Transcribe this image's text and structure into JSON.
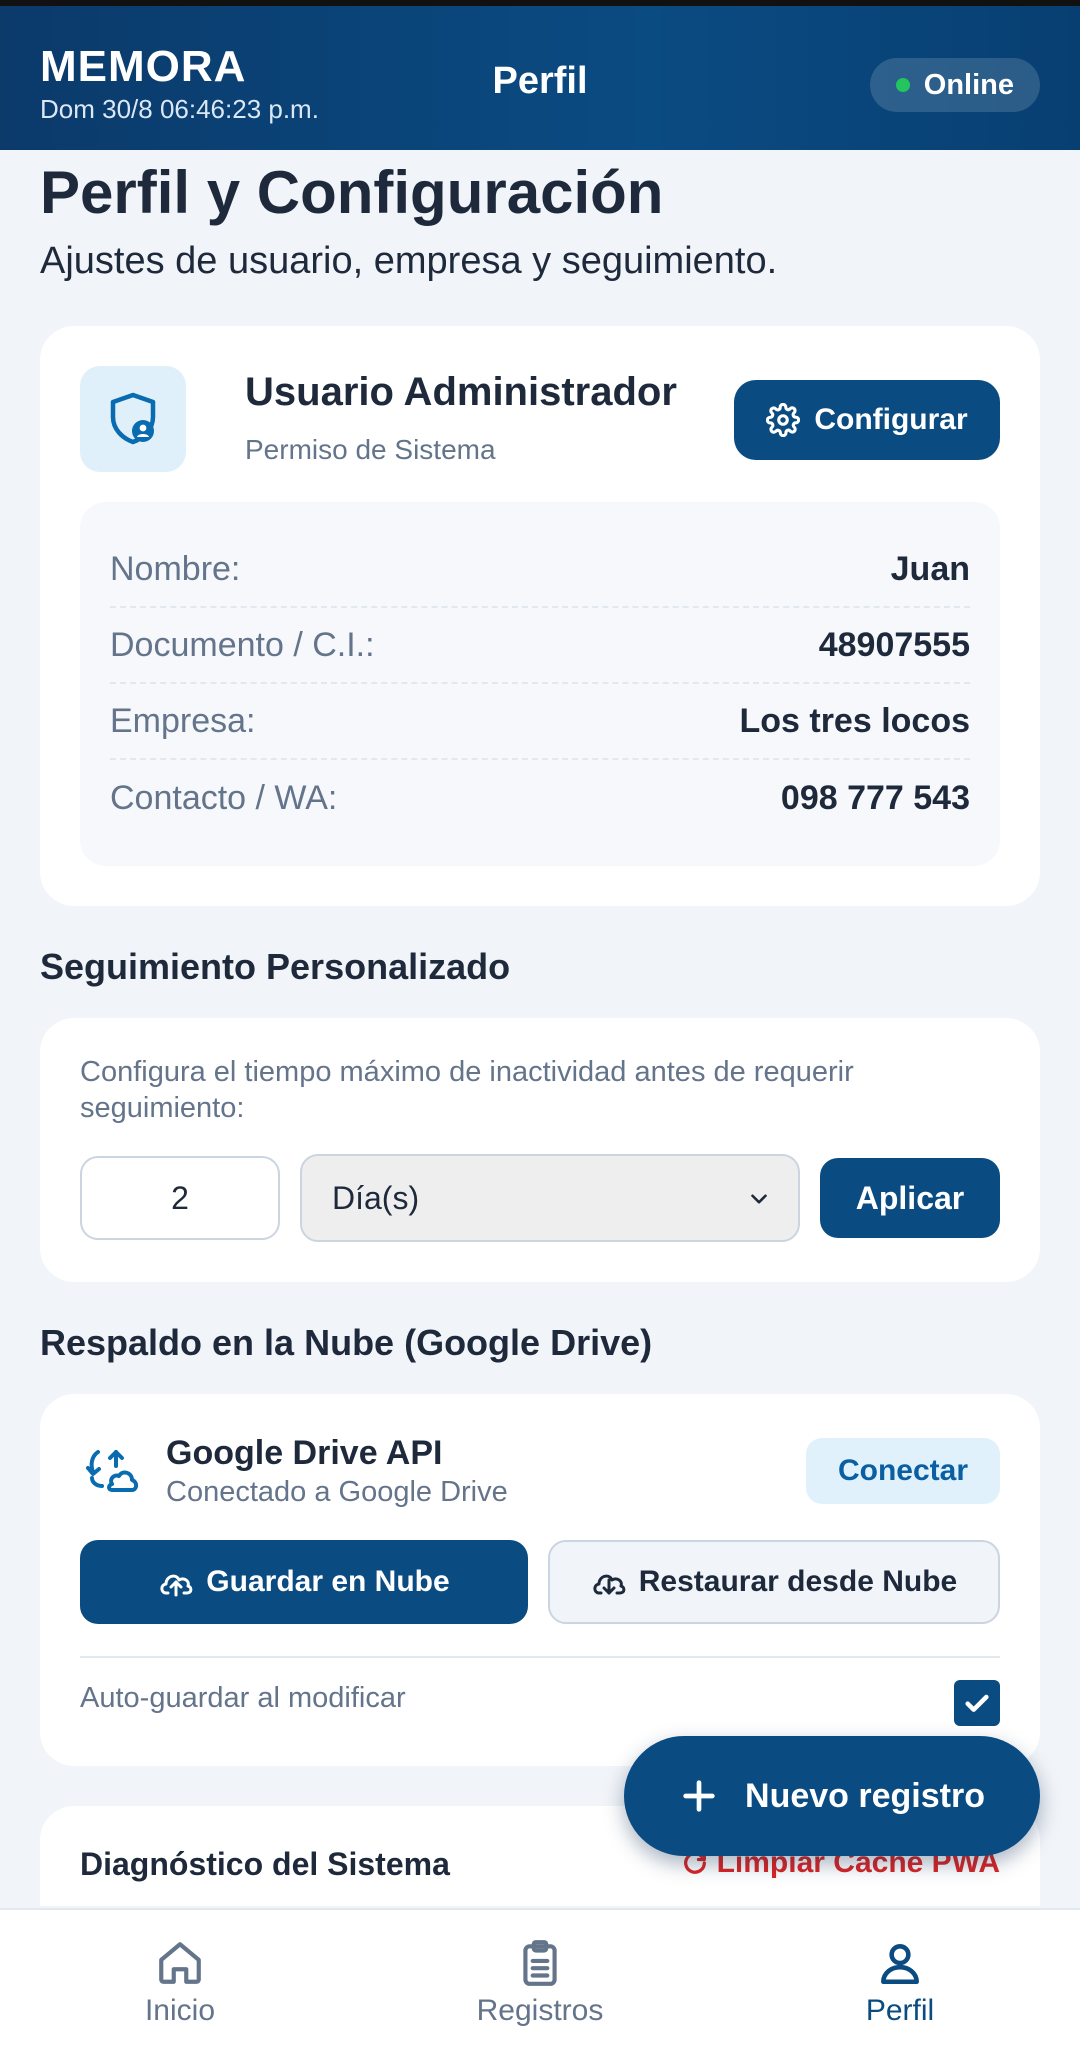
{
  "header": {
    "brand": "MEMORA",
    "clock": "Dom 30/8 06:46:23 p.m.",
    "title": "Perfil",
    "status": "Online"
  },
  "page": {
    "title": "Perfil y Configuración",
    "subtitle": "Ajustes de usuario, empresa y seguimiento."
  },
  "profile": {
    "name": "Usuario Administrador",
    "role": "Permiso de Sistema",
    "config_label": "Configurar",
    "fields": [
      {
        "label": "Nombre:",
        "value": "Juan"
      },
      {
        "label": "Documento / C.I.:",
        "value": "48907555"
      },
      {
        "label": "Empresa:",
        "value": "Los tres locos"
      },
      {
        "label": "Contacto / WA:",
        "value": "098 777 543"
      }
    ]
  },
  "seguimiento": {
    "title": "Seguimiento Personalizado",
    "description": "Configura el tiempo máximo de inactividad antes de requerir seguimiento:",
    "amount": "2",
    "unit": "Día(s)",
    "apply_label": "Aplicar"
  },
  "drive": {
    "section_title": "Respaldo en la Nube (Google Drive)",
    "name": "Google Drive API",
    "status": "Conectado a Google Drive",
    "connect_label": "Conectar",
    "save_label": "Guardar en Nube",
    "restore_label": "Restaurar desde Nube",
    "autosave_label": "Auto-guardar al modificar",
    "autosave_checked": true
  },
  "diagnostico": {
    "title": "Diagnóstico del Sistema",
    "clear_label": "Limpiar Caché PWA"
  },
  "fab": {
    "label": "Nuevo registro"
  },
  "nav": {
    "items": [
      {
        "label": "Inicio",
        "icon": "home-icon"
      },
      {
        "label": "Registros",
        "icon": "clipboard-icon"
      },
      {
        "label": "Perfil",
        "icon": "user-icon"
      }
    ]
  },
  "colors": {
    "primary": "#0a4b82",
    "danger": "#dc2626",
    "online": "#22c55e"
  }
}
